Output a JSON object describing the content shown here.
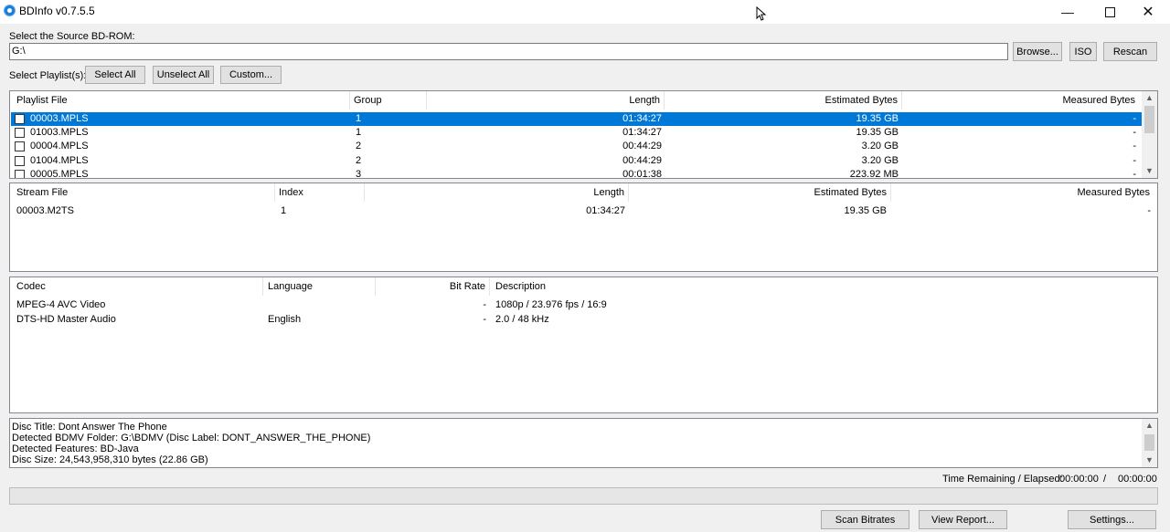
{
  "window": {
    "title": "BDInfo v0.7.5.5",
    "minimize_icon": "minimize-icon",
    "maximize_icon": "maximize-icon",
    "close_icon": "close-icon"
  },
  "source": {
    "label": "Select the Source BD-ROM:",
    "path_value": "G:\\",
    "browse_label": "Browse...",
    "iso_label": "ISO",
    "rescan_label": "Rescan"
  },
  "playlist_controls": {
    "label": "Select Playlist(s):",
    "select_all_label": "Select All",
    "unselect_all_label": "Unselect All",
    "custom_label": "Custom..."
  },
  "playlists": {
    "columns": [
      "Playlist File",
      "Group",
      "Length",
      "Estimated Bytes",
      "Measured Bytes"
    ],
    "rows": [
      {
        "file": "00003.MPLS",
        "group": "1",
        "length": "01:34:27",
        "est": "19.35 GB",
        "meas": "-",
        "selected": true
      },
      {
        "file": "01003.MPLS",
        "group": "1",
        "length": "01:34:27",
        "est": "19.35 GB",
        "meas": "-",
        "selected": false
      },
      {
        "file": "00004.MPLS",
        "group": "2",
        "length": "00:44:29",
        "est": "3.20 GB",
        "meas": "-",
        "selected": false
      },
      {
        "file": "01004.MPLS",
        "group": "2",
        "length": "00:44:29",
        "est": "3.20 GB",
        "meas": "-",
        "selected": false
      },
      {
        "file": "00005.MPLS",
        "group": "3",
        "length": "00:01:38",
        "est": "223.92 MB",
        "meas": "-",
        "selected": false
      }
    ]
  },
  "streams": {
    "columns": [
      "Stream File",
      "Index",
      "Length",
      "Estimated Bytes",
      "Measured Bytes"
    ],
    "rows": [
      {
        "file": "00003.M2TS",
        "index": "1",
        "length": "01:34:27",
        "est": "19.35 GB",
        "meas": "-"
      }
    ]
  },
  "codecs": {
    "columns": [
      "Codec",
      "Language",
      "Bit Rate",
      "Description"
    ],
    "rows": [
      {
        "codec": "MPEG-4 AVC Video",
        "language": "",
        "bitrate": "-",
        "description": "1080p / 23.976 fps / 16:9"
      },
      {
        "codec": "DTS-HD Master Audio",
        "language": "English",
        "bitrate": "-",
        "description": "2.0 / 48 kHz"
      }
    ]
  },
  "log": {
    "lines": [
      "Disc Title: Dont Answer The Phone",
      "Detected BDMV Folder: G:\\BDMV (Disc Label: DONT_ANSWER_THE_PHONE)",
      "Detected Features: BD-Java",
      "Disc Size: 24,543,958,310 bytes (22.86 GB)"
    ]
  },
  "timer": {
    "label": "Time Remaining / Elapsed:",
    "remaining": "00:00:00",
    "separator": "/",
    "elapsed": "00:00:00"
  },
  "progress": 0,
  "footer": {
    "scan_label": "Scan Bitrates",
    "report_label": "View Report...",
    "settings_label": "Settings..."
  },
  "colors": {
    "selection": "#0078d7",
    "window_bg": "#f0f0f0"
  }
}
